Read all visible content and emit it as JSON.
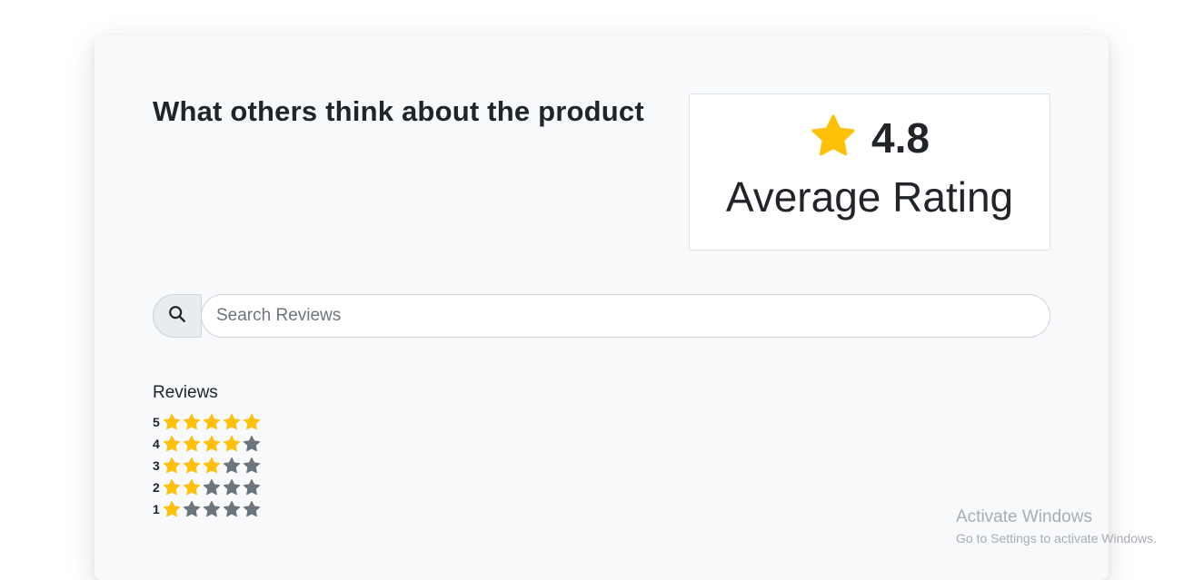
{
  "heading": "What others think about the product",
  "rating": {
    "value": "4.8",
    "label": "Average Rating",
    "icon": "star-icon"
  },
  "search": {
    "placeholder": "Search Reviews",
    "icon": "search-icon"
  },
  "reviews": {
    "title": "Reviews",
    "rows": [
      {
        "label": "5",
        "filled": 5
      },
      {
        "label": "4",
        "filled": 4
      },
      {
        "label": "3",
        "filled": 3
      },
      {
        "label": "2",
        "filled": 2
      },
      {
        "label": "1",
        "filled": 1
      }
    ]
  },
  "colors": {
    "star_filled": "#ffc107",
    "star_empty": "#6c757d",
    "card_bg": "#f8f9fa"
  },
  "watermark": {
    "line1": "Activate Windows",
    "line2": "Go to Settings to activate Windows."
  }
}
